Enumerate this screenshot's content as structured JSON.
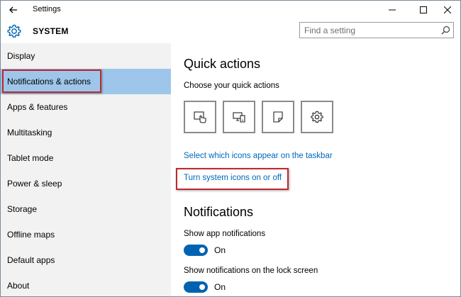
{
  "window": {
    "title": "Settings",
    "controls": [
      "minimize",
      "maximize",
      "close"
    ]
  },
  "header": {
    "section_title": "SYSTEM",
    "search_placeholder": "Find a setting"
  },
  "sidebar": {
    "items": [
      {
        "label": "Display",
        "selected": false
      },
      {
        "label": "Notifications & actions",
        "selected": true
      },
      {
        "label": "Apps & features",
        "selected": false
      },
      {
        "label": "Multitasking",
        "selected": false
      },
      {
        "label": "Tablet mode",
        "selected": false
      },
      {
        "label": "Power & sleep",
        "selected": false
      },
      {
        "label": "Storage",
        "selected": false
      },
      {
        "label": "Offline maps",
        "selected": false
      },
      {
        "label": "Default apps",
        "selected": false
      },
      {
        "label": "About",
        "selected": false
      }
    ]
  },
  "main": {
    "quick_actions": {
      "heading": "Quick actions",
      "subheading": "Choose your quick actions",
      "tiles": [
        {
          "icon": "tablet-mode-icon"
        },
        {
          "icon": "connect-icon"
        },
        {
          "icon": "note-icon"
        },
        {
          "icon": "settings-icon"
        }
      ]
    },
    "links": {
      "taskbar_icons": "Select which icons appear on the taskbar",
      "system_icons": "Turn system icons on or off"
    },
    "notifications": {
      "heading": "Notifications",
      "settings": [
        {
          "label": "Show app notifications",
          "state": "On"
        },
        {
          "label": "Show notifications on the lock screen",
          "state": "On"
        }
      ]
    }
  },
  "colors": {
    "accent": "#0063b1",
    "selection": "#9ec6ea",
    "link": "#0067b8",
    "annotation_red": "#c0272d"
  }
}
